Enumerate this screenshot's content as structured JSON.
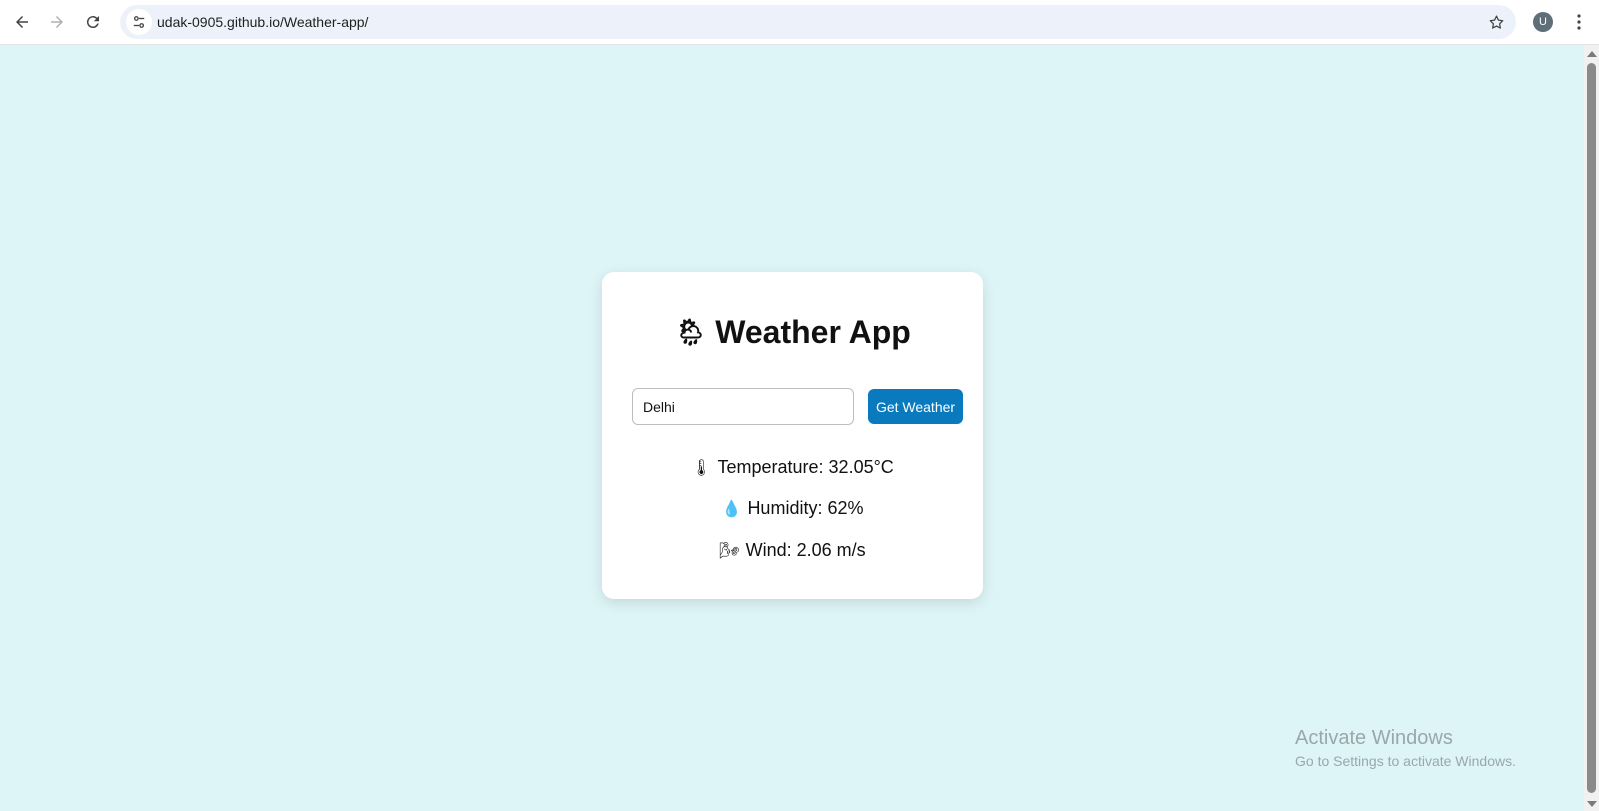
{
  "browser": {
    "url": "udak-0905.github.io/Weather-app/",
    "avatar_letter": "U"
  },
  "app": {
    "title": "Weather App",
    "title_icon": "🌦",
    "city_input_value": "Delhi",
    "button_label": "Get Weather",
    "accent_color": "#0a7abf",
    "background_color": "#def5f7"
  },
  "weather": {
    "temperature_icon": "🌡",
    "temperature_text": "Temperature: 32.05°C",
    "humidity_icon": "💧",
    "humidity_text": "Humidity: 62%",
    "wind_icon": "🌬",
    "wind_text": "Wind: 2.06 m/s"
  },
  "watermark": {
    "title": "Activate Windows",
    "subtitle": "Go to Settings to activate Windows."
  }
}
